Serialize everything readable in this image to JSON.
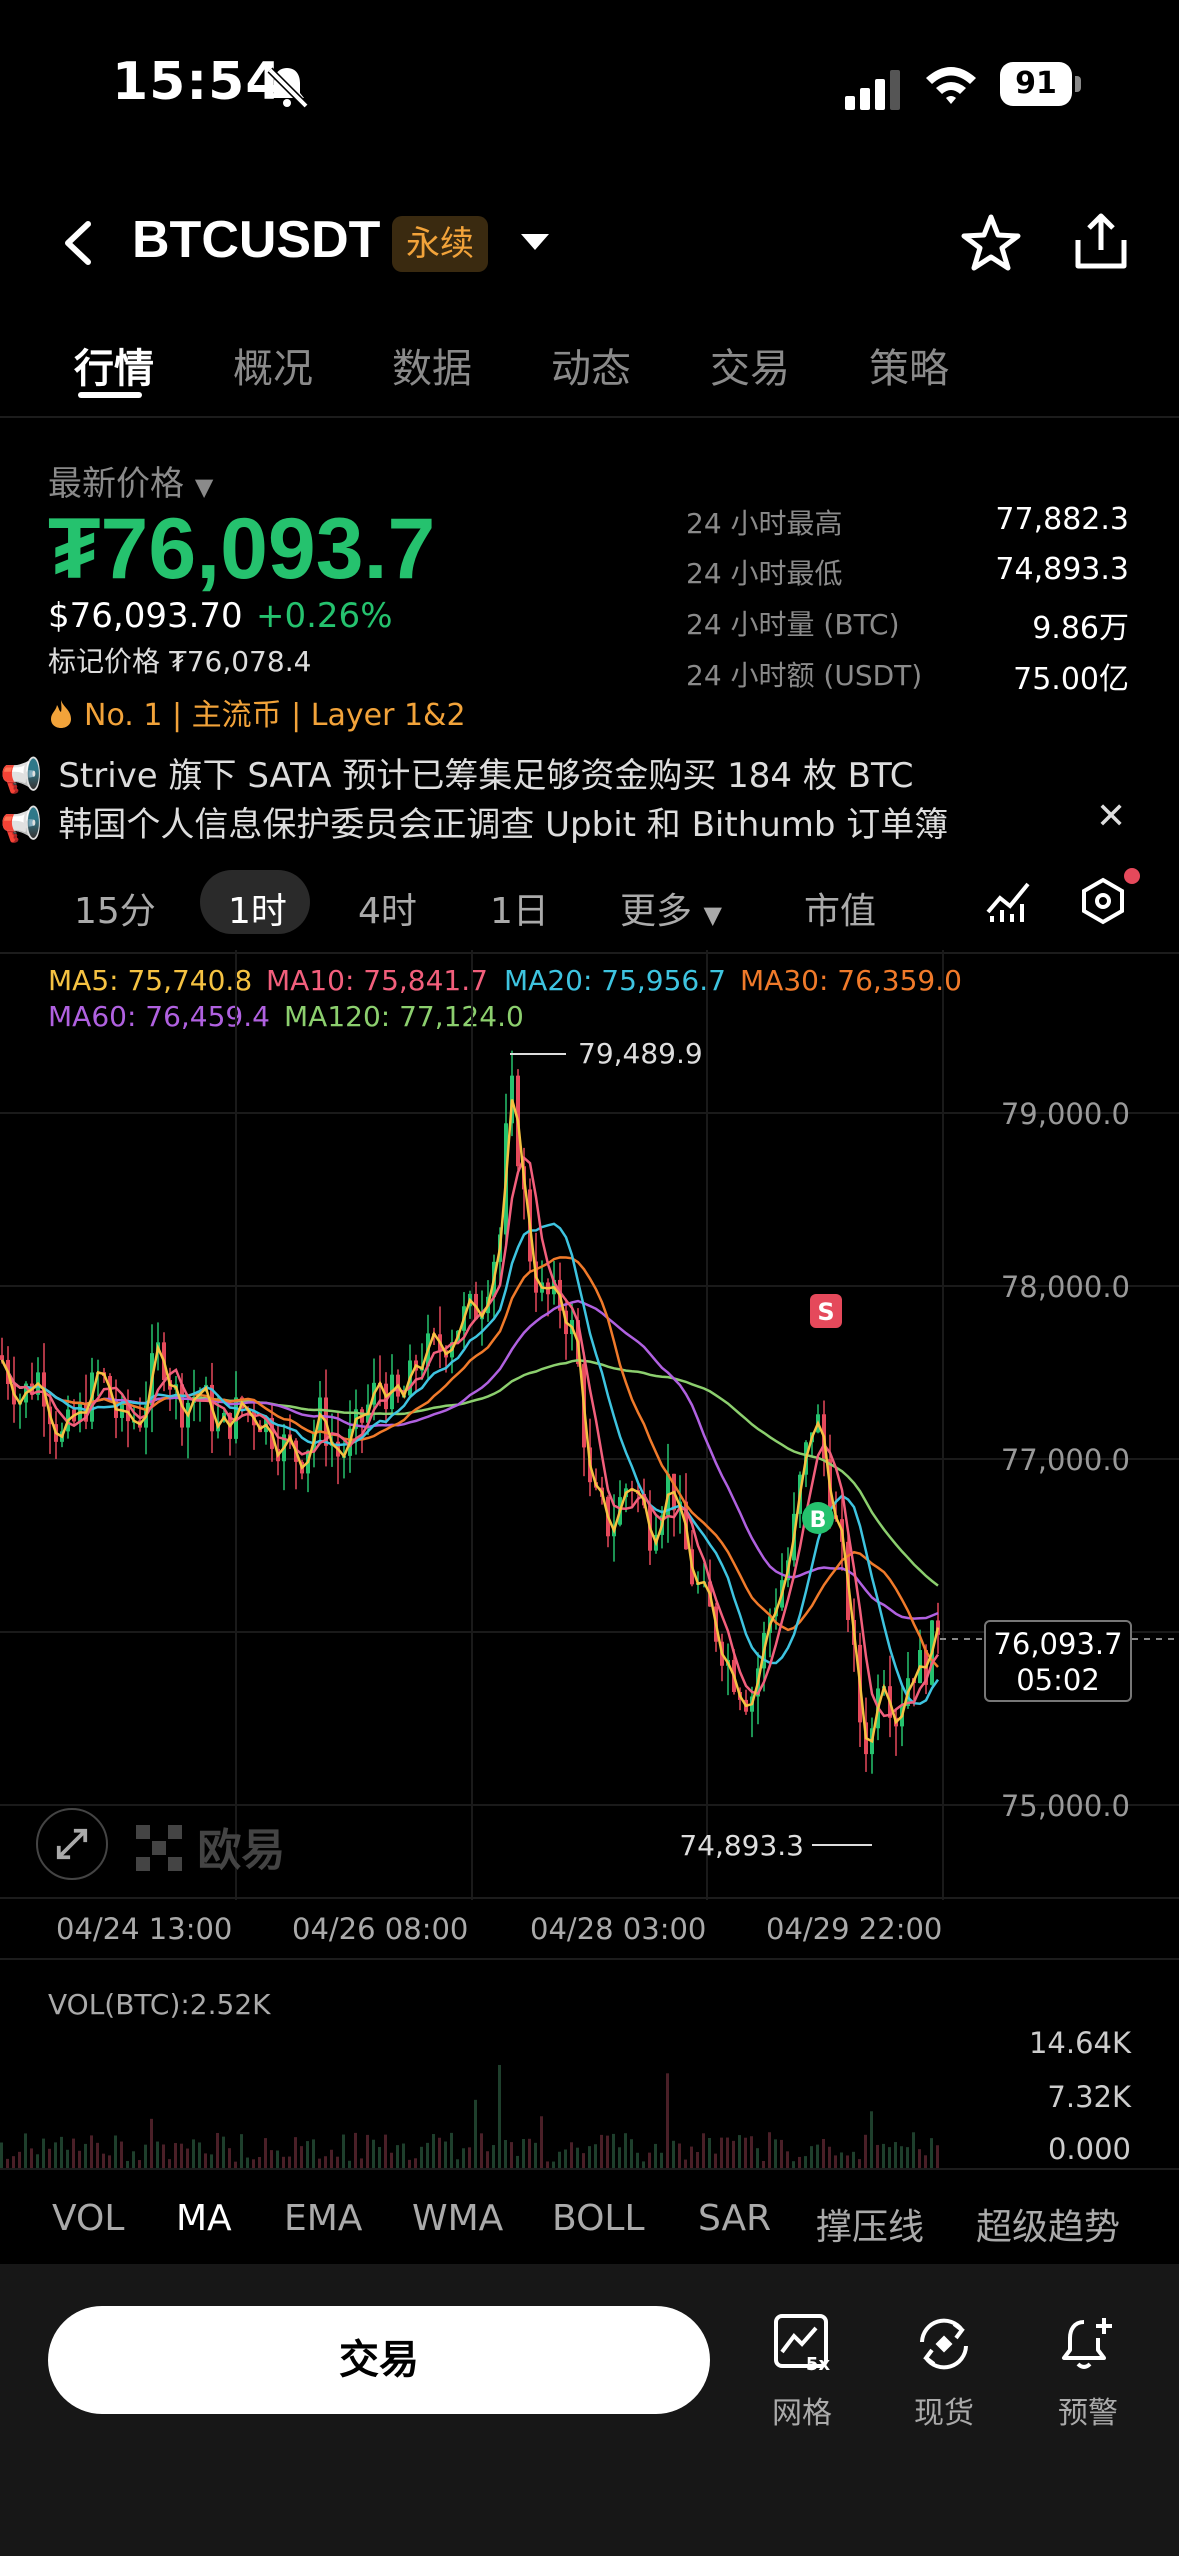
{
  "status": {
    "time": "15:54",
    "battery": "91"
  },
  "header": {
    "symbol": "BTCUSDT",
    "tag": "永续"
  },
  "tabs": [
    "行情",
    "概况",
    "数据",
    "动态",
    "交易",
    "策略"
  ],
  "price": {
    "label": "最新价格",
    "main": "₮76,093.7",
    "usd": "$76,093.70",
    "change": "+0.26%",
    "mark": "标记价格 ₮76,078.4",
    "tags": "No. 1  |  主流币  |  Layer 1&2"
  },
  "stats": [
    {
      "label": "24 小时最高",
      "value": "77,882.3"
    },
    {
      "label": "24 小时最低",
      "value": "74,893.3"
    },
    {
      "label": "24 小时量 (BTC)",
      "value": "9.86万"
    },
    {
      "label": "24 小时额 (USDT)",
      "value": "75.00亿"
    }
  ],
  "news": [
    "Strive 旗下 SATA 预计已筹集足够资金购买 184 枚 BTC",
    "韩国个人信息保护委员会正调查 Upbit 和 Bithumb 订单簿"
  ],
  "timeframes": [
    "15分",
    "1时",
    "4时",
    "1日",
    "更多",
    "市值"
  ],
  "ma": {
    "ma5": "MA5: 75,740.8",
    "ma10": "MA10: 75,841.7",
    "ma20": "MA20: 75,956.7",
    "ma30": "MA30: 76,359.0",
    "ma60": "MA60: 76,459.4",
    "ma120": "MA120: 77,124.0"
  },
  "chart": {
    "high_label": "79,489.9",
    "low_label": "74,893.3",
    "y_ticks": [
      "79,000.0",
      "78,000.0",
      "77,000.0",
      "75,000.0"
    ],
    "last_price": "76,093.7",
    "countdown": "05:02",
    "x_ticks": [
      "04/24 13:00",
      "04/26 08:00",
      "04/28 03:00",
      "04/29 22:00"
    ],
    "logo": "欧易",
    "markers": {
      "sell": "S",
      "buy": "B"
    }
  },
  "volume": {
    "label": "VOL(BTC):2.52K",
    "ticks": [
      "14.64K",
      "7.32K",
      "0.000"
    ]
  },
  "indicators": [
    "VOL",
    "MA",
    "EMA",
    "WMA",
    "BOLL",
    "SAR",
    "撑压线",
    "超级趋势"
  ],
  "bottom": {
    "trade": "交易",
    "tools": [
      "网格",
      "现货",
      "预警"
    ]
  },
  "colors": {
    "up": "#25c26e",
    "down": "#e5495b",
    "ma5": "#f5c242",
    "ma10": "#f25f7c",
    "ma20": "#3ec4e0",
    "ma30": "#f07a2a",
    "ma60": "#b061e0",
    "ma120": "#8ccf6e"
  }
}
